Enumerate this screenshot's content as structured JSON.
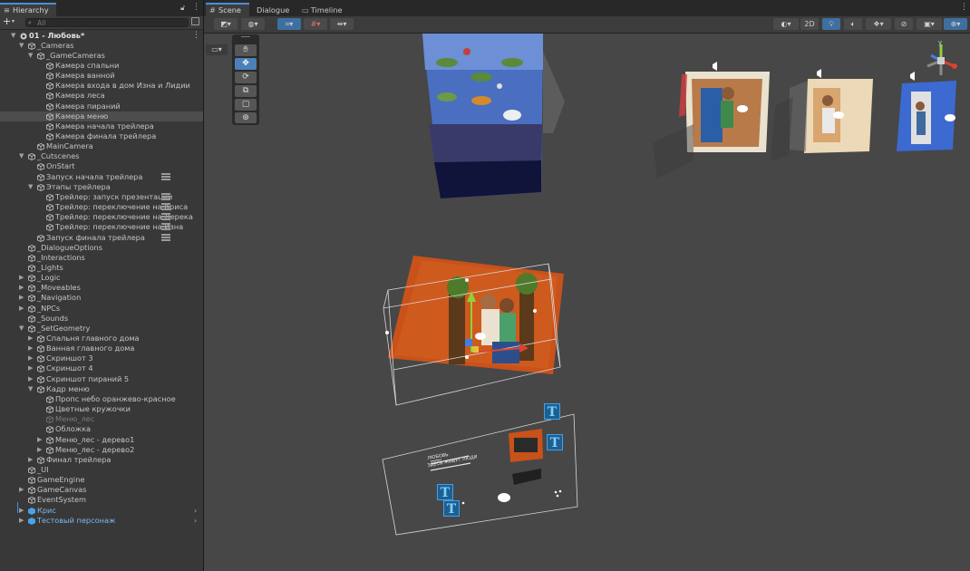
{
  "hierarchy": {
    "tab_label": "Hierarchy",
    "search_placeholder": "All",
    "rows": [
      {
        "depth": 0,
        "arrow": "▼",
        "icon": "scene",
        "label": "01 - Любовь*",
        "bold": true
      },
      {
        "depth": 1,
        "arrow": "▼",
        "icon": "cube",
        "label": "_Cameras"
      },
      {
        "depth": 2,
        "arrow": "▼",
        "icon": "cube",
        "label": "_GameCameras"
      },
      {
        "depth": 3,
        "arrow": "",
        "icon": "cube",
        "label": "Камера спальни"
      },
      {
        "depth": 3,
        "arrow": "",
        "icon": "cube",
        "label": "Камера ванной"
      },
      {
        "depth": 3,
        "arrow": "",
        "icon": "cube",
        "label": "Камера входа в дом Изна и Лидии"
      },
      {
        "depth": 3,
        "arrow": "",
        "icon": "cube",
        "label": "Камера леса"
      },
      {
        "depth": 3,
        "arrow": "",
        "icon": "cube",
        "label": "Камера пираний"
      },
      {
        "depth": 3,
        "arrow": "",
        "icon": "cube",
        "label": "Камера меню",
        "selected": true
      },
      {
        "depth": 3,
        "arrow": "",
        "icon": "cube",
        "label": "Камера начала трейлера"
      },
      {
        "depth": 3,
        "arrow": "",
        "icon": "cube",
        "label": "Камера финала трейлера"
      },
      {
        "depth": 2,
        "arrow": "",
        "icon": "cube",
        "label": "MainCamera"
      },
      {
        "depth": 1,
        "arrow": "▼",
        "icon": "cube",
        "label": "_Cutscenes"
      },
      {
        "depth": 2,
        "arrow": "",
        "icon": "cube",
        "label": "OnStart"
      },
      {
        "depth": 2,
        "arrow": "",
        "icon": "cube",
        "label": "Запуск начала трейлера",
        "handle": true
      },
      {
        "depth": 2,
        "arrow": "▼",
        "icon": "cube",
        "label": "Этапы трейлера"
      },
      {
        "depth": 3,
        "arrow": "",
        "icon": "cube",
        "label": "Трейлер: запуск презентации",
        "handle": true
      },
      {
        "depth": 3,
        "arrow": "",
        "icon": "cube",
        "label": "Трейлер: переключение на Криса",
        "handle": true
      },
      {
        "depth": 3,
        "arrow": "",
        "icon": "cube",
        "label": "Трейлер: переключение на Дерека",
        "handle": true
      },
      {
        "depth": 3,
        "arrow": "",
        "icon": "cube",
        "label": "Трейлер: переключение на Изна",
        "handle": true
      },
      {
        "depth": 2,
        "arrow": "",
        "icon": "cube",
        "label": "Запуск финала трейлера",
        "handle": true
      },
      {
        "depth": 1,
        "arrow": "",
        "icon": "cube",
        "label": "_DialogueOptions"
      },
      {
        "depth": 1,
        "arrow": "",
        "icon": "cube",
        "label": "_Interactions"
      },
      {
        "depth": 1,
        "arrow": "",
        "icon": "cube",
        "label": "_Lights"
      },
      {
        "depth": 1,
        "arrow": "▶",
        "icon": "cube",
        "label": "_Logic"
      },
      {
        "depth": 1,
        "arrow": "▶",
        "icon": "cube",
        "label": "_Moveables"
      },
      {
        "depth": 1,
        "arrow": "▶",
        "icon": "cube",
        "label": "_Navigation"
      },
      {
        "depth": 1,
        "arrow": "▶",
        "icon": "cube",
        "label": "_NPCs"
      },
      {
        "depth": 1,
        "arrow": "",
        "icon": "cube",
        "label": "_Sounds"
      },
      {
        "depth": 1,
        "arrow": "▼",
        "icon": "cube",
        "label": "_SetGeometry"
      },
      {
        "depth": 2,
        "arrow": "▶",
        "icon": "cube",
        "label": "Спальня главного дома"
      },
      {
        "depth": 2,
        "arrow": "▶",
        "icon": "cube",
        "label": "Ванная главного дома"
      },
      {
        "depth": 2,
        "arrow": "▶",
        "icon": "cube",
        "label": "Скриншот 3"
      },
      {
        "depth": 2,
        "arrow": "▶",
        "icon": "cube",
        "label": "Скриншот 4"
      },
      {
        "depth": 2,
        "arrow": "▶",
        "icon": "cube",
        "label": "Скриншот пираний 5"
      },
      {
        "depth": 2,
        "arrow": "▼",
        "icon": "cube",
        "label": "Кадр меню"
      },
      {
        "depth": 3,
        "arrow": "",
        "icon": "cube",
        "label": "Пропс небо оранжево-красное"
      },
      {
        "depth": 3,
        "arrow": "",
        "icon": "cube",
        "label": "Цветные кружочки"
      },
      {
        "depth": 3,
        "arrow": "",
        "icon": "cube",
        "label": "Меню_лес",
        "disabled": true
      },
      {
        "depth": 3,
        "arrow": "",
        "icon": "cube",
        "label": "Обложка"
      },
      {
        "depth": 3,
        "arrow": "▶",
        "icon": "cube",
        "label": "Меню_лес - дерево1"
      },
      {
        "depth": 3,
        "arrow": "▶",
        "icon": "cube",
        "label": "Меню_лес - дерево2"
      },
      {
        "depth": 2,
        "arrow": "▶",
        "icon": "cube",
        "label": "Финал трейлера"
      },
      {
        "depth": 1,
        "arrow": "",
        "icon": "cube",
        "label": "_UI"
      },
      {
        "depth": 1,
        "arrow": "",
        "icon": "cube",
        "label": "GameEngine"
      },
      {
        "depth": 1,
        "arrow": "▶",
        "icon": "cube",
        "label": "GameCanvas"
      },
      {
        "depth": 1,
        "arrow": "",
        "icon": "cube",
        "label": "EventSystem"
      },
      {
        "depth": 1,
        "arrow": "▶",
        "icon": "prefab",
        "label": "Крис",
        "prefab": true,
        "chevron": true
      },
      {
        "depth": 1,
        "arrow": "▶",
        "icon": "prefab",
        "label": "Тестовый персонаж",
        "prefab": true,
        "chevron": true
      }
    ]
  },
  "scene": {
    "tabs": [
      {
        "label": "Scene",
        "icon": "grid-icon",
        "active": true
      },
      {
        "label": "Dialogue",
        "icon": "",
        "active": false
      },
      {
        "label": "Timeline",
        "icon": "timeline-icon",
        "active": false
      }
    ],
    "toolbar_2d_label": "2D",
    "menu_text": {
      "title": "ЛЮБОВЬ",
      "subtitle": "ЗДЕСЬ ЖИВУТ ЛЮДИ"
    },
    "text_gizmo_glyph": "T"
  },
  "colors": {
    "accent": "#4a8fd8",
    "selection": "#4d4d4d",
    "prefab": "#7db9f0",
    "orange_sky": "#c9511a",
    "gizmo_x": "#e0412f",
    "gizmo_y": "#8fd13b",
    "gizmo_z": "#3f7fe0"
  }
}
